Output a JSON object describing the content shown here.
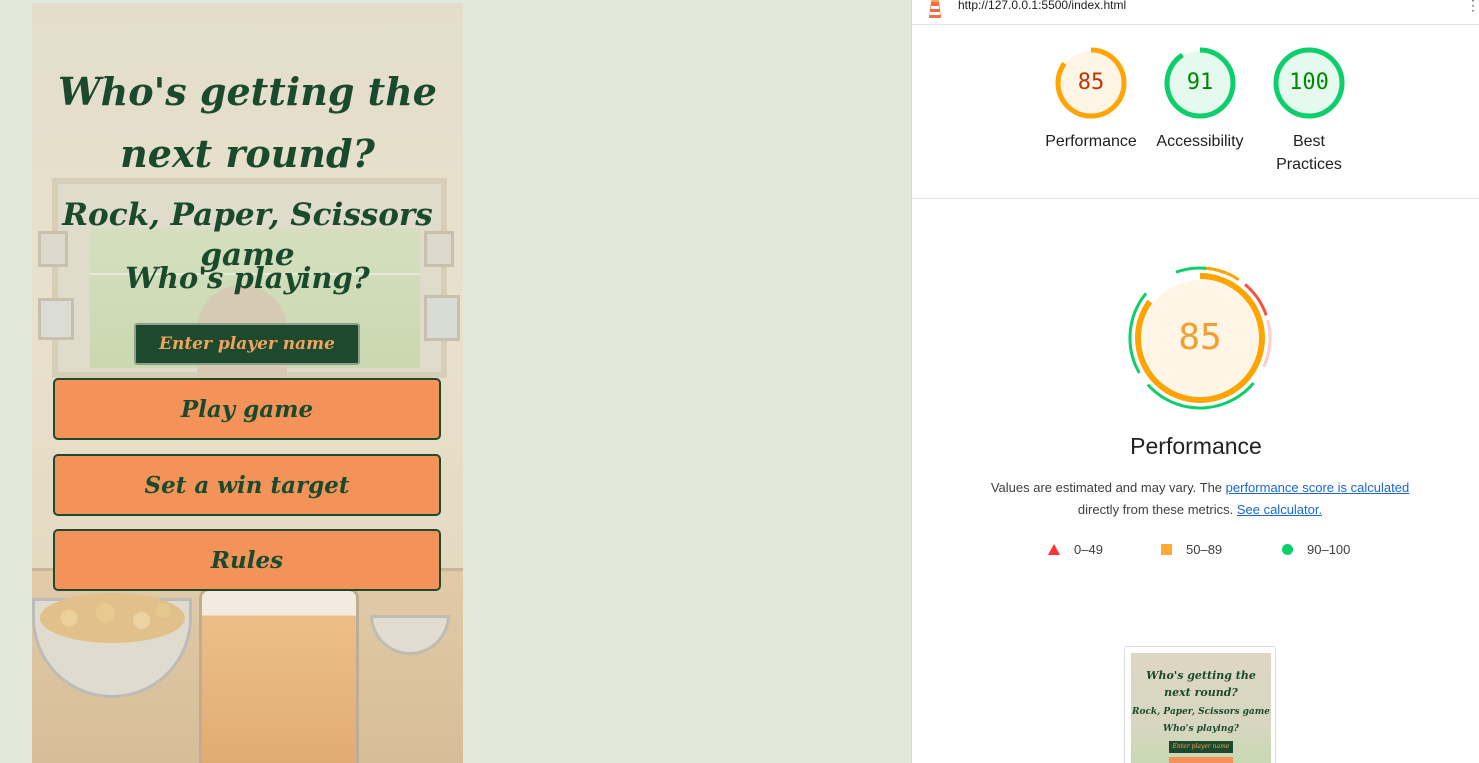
{
  "game": {
    "title_line1": "Who's getting the",
    "title_line2": "next round?",
    "subtitle": "Rock, Paper, Scissors game",
    "prompt": "Who's playing?",
    "name_placeholder": "Enter player name",
    "buttons": {
      "play": "Play game",
      "target": "Set a win target",
      "rules": "Rules"
    },
    "colors": {
      "title": "#1a4a2c",
      "button_bg": "#f3935a",
      "input_bg": "#1d4a2d",
      "input_text": "#f4a35f"
    }
  },
  "lighthouse": {
    "url": "http://127.0.0.1:5500/index.html",
    "menu_icon": "vertical-dots-icon",
    "logo_icon": "lighthouse-icon",
    "gauges": [
      {
        "score": 85,
        "label": "Performance",
        "color": "#ffa400"
      },
      {
        "score": 91,
        "label": "Accessibility",
        "color": "#0cce6b"
      },
      {
        "score": 100,
        "label_line1": "Best",
        "label_line2": "Practices",
        "color": "#0cce6b"
      }
    ],
    "main": {
      "score": "85",
      "label": "Performance",
      "desc_prefix": "Values are estimated and may vary. The ",
      "desc_link1": "performance score is calculated",
      "desc_mid": " directly from these metrics. ",
      "desc_link2": "See calculator."
    },
    "legend": [
      {
        "range": "0–49",
        "shape": "triangle",
        "color": "#ff3333"
      },
      {
        "range": "50–89",
        "shape": "square",
        "color": "#ffaa33"
      },
      {
        "range": "90–100",
        "shape": "circle",
        "color": "#0cce6b"
      }
    ],
    "thumbnail": {
      "title": "Who's getting the next round?",
      "subtitle": "Rock, Paper, Scissors game",
      "prompt": "Who's playing?",
      "input": "Enter player name"
    }
  }
}
